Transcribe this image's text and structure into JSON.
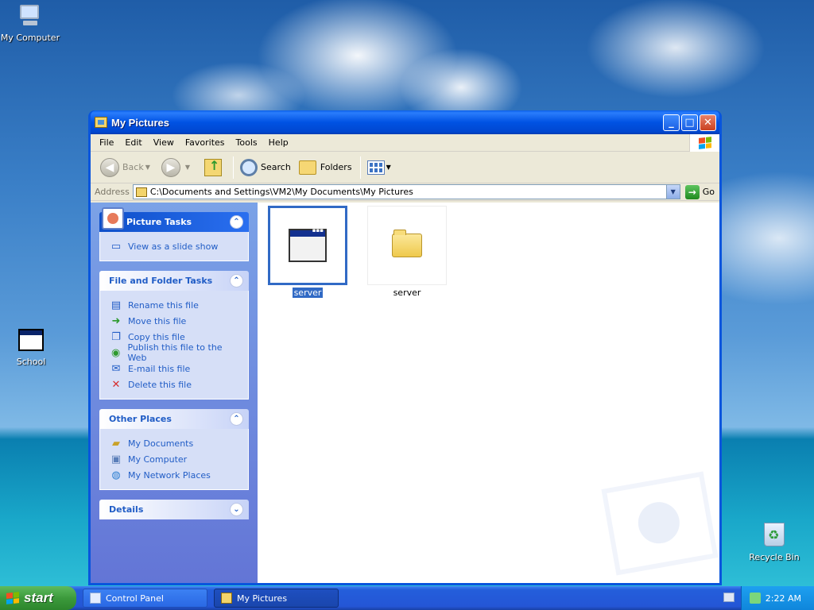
{
  "desktop": {
    "icons": [
      {
        "label": "My Computer"
      },
      {
        "label": "School"
      },
      {
        "label": "Recycle Bin"
      }
    ]
  },
  "window": {
    "title": "My Pictures",
    "controls": {
      "minimize": "_",
      "maximize": "□",
      "close": "✕"
    },
    "menu": [
      "File",
      "Edit",
      "View",
      "Favorites",
      "Tools",
      "Help"
    ],
    "toolbar": {
      "back": "Back",
      "search": "Search",
      "folders": "Folders"
    },
    "address": {
      "label": "Address",
      "path": "C:\\Documents and Settings\\VM2\\My Documents\\My Pictures",
      "go": "Go"
    }
  },
  "taskpane": {
    "picture_tasks": {
      "title": "Picture Tasks",
      "items": [
        {
          "label": "View as a slide show"
        }
      ]
    },
    "file_folder_tasks": {
      "title": "File and Folder Tasks",
      "items": [
        {
          "label": "Rename this file"
        },
        {
          "label": "Move this file"
        },
        {
          "label": "Copy this file"
        },
        {
          "label": "Publish this file to the Web"
        },
        {
          "label": "E-mail this file"
        },
        {
          "label": "Delete this file"
        }
      ]
    },
    "other_places": {
      "title": "Other Places",
      "items": [
        {
          "label": "My Documents"
        },
        {
          "label": "My Computer"
        },
        {
          "label": "My Network Places"
        }
      ]
    },
    "details": {
      "title": "Details"
    }
  },
  "files": [
    {
      "name": "server",
      "type": "application",
      "selected": true
    },
    {
      "name": "server",
      "type": "folder",
      "selected": false
    }
  ],
  "taskbar": {
    "start": "start",
    "buttons": [
      {
        "label": "Control Panel",
        "active": false
      },
      {
        "label": "My Pictures",
        "active": true
      }
    ],
    "clock": "2:22 AM"
  }
}
